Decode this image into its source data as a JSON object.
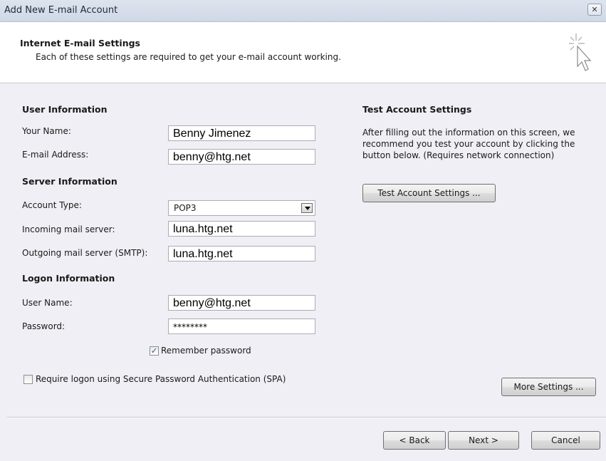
{
  "window": {
    "title": "Add New E-mail Account",
    "close_label": "✕"
  },
  "header": {
    "title": "Internet E-mail Settings",
    "subtitle": "Each of these settings are required to get your e-mail account working."
  },
  "user_info": {
    "heading": "User Information",
    "name_label": "Your Name:",
    "name_value": "Benny Jimenez",
    "email_label": "E-mail Address:",
    "email_value": "benny@htg.net"
  },
  "server_info": {
    "heading": "Server Information",
    "account_type_label": "Account Type:",
    "account_type_value": "POP3",
    "incoming_label": "Incoming mail server:",
    "incoming_value": "luna.htg.net",
    "outgoing_label": "Outgoing mail server (SMTP):",
    "outgoing_value": "luna.htg.net"
  },
  "logon_info": {
    "heading": "Logon Information",
    "username_label": "User Name:",
    "username_value": "benny@htg.net",
    "password_label": "Password:",
    "password_value": "********",
    "remember_label": "Remember password",
    "remember_checked": true,
    "spa_label": "Require logon using Secure Password Authentication (SPA)",
    "spa_checked": false
  },
  "test_settings": {
    "heading": "Test Account Settings",
    "description": "After filling out the information on this screen, we recommend you test your account by clicking the button below. (Requires network connection)",
    "button_label": "Test Account Settings ..."
  },
  "buttons": {
    "more_settings": "More Settings ...",
    "back": "< Back",
    "next": "Next >",
    "cancel": "Cancel"
  },
  "icons": {
    "header_icon": "cursor-sparkle-icon",
    "checkmark": "✓"
  }
}
